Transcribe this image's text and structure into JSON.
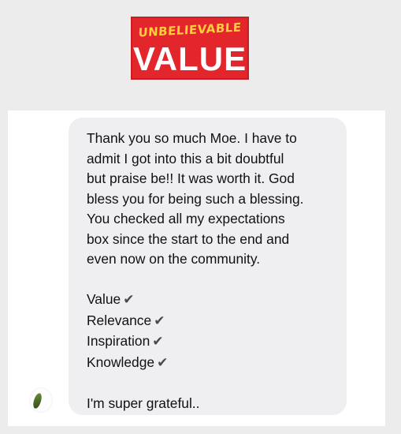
{
  "logo": {
    "top_text": "UNBELIEVABLE",
    "bottom_text": "VALUE",
    "colors": {
      "background": "#e3262c",
      "top_text": "#ffcf3a",
      "bottom_text": "#ffffff"
    }
  },
  "message": {
    "paragraph_lines": [
      "Thank you so much Moe. I have to",
      "admit I got into this a bit doubtful",
      "but praise be!! It was worth it. God",
      "bless you for being such a blessing.",
      "You checked all my expectations",
      "box since the start to the end and",
      "even now on the community."
    ],
    "checklist": [
      {
        "label": "Value",
        "icon": "check-mark-icon",
        "glyph": "✔"
      },
      {
        "label": "Relevance",
        "icon": "check-mark-icon",
        "glyph": "✔"
      },
      {
        "label": "Inspiration",
        "icon": "check-mark-icon",
        "glyph": "✔"
      },
      {
        "label": "Knowledge",
        "icon": "check-mark-icon",
        "glyph": "✔"
      }
    ],
    "closing": "I'm super grateful..",
    "bubble_color": "#efeff1"
  },
  "sender": {
    "avatar_icon": "leaf-avatar-icon"
  }
}
